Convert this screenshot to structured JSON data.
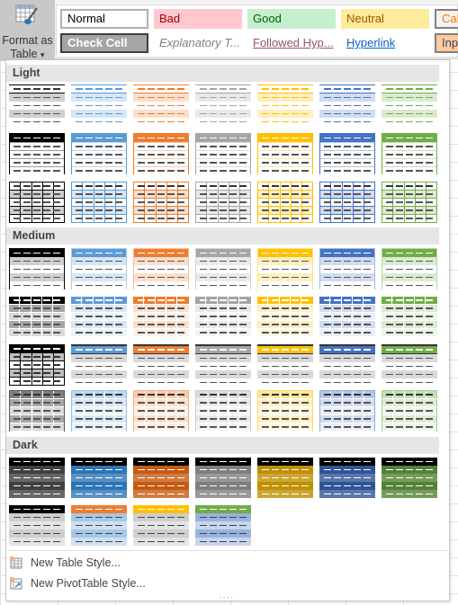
{
  "ribbon": {
    "format_as_table": {
      "line1": "Format as",
      "line2": "Table",
      "icon": "table-format-icon",
      "chevron": "▾"
    },
    "cell_styles": [
      {
        "label": "Normal",
        "bg": "#ffffff",
        "color": "#000000",
        "border": "#b0b0b0"
      },
      {
        "label": "Bad",
        "bg": "#ffc7ce",
        "color": "#9c0006"
      },
      {
        "label": "Good",
        "bg": "#c6efce",
        "color": "#006100"
      },
      {
        "label": "Neutral",
        "bg": "#ffeb9c",
        "color": "#9c5700"
      },
      {
        "label": "Calc",
        "bg": "#f2f2f2",
        "color": "#fa7d00",
        "border": "#7f7f7f"
      },
      {
        "label": "Check Cell",
        "bg": "#a5a5a5",
        "color": "#ffffff",
        "border": "#3f3f3f",
        "bold": true
      },
      {
        "label": "Explanatory T...",
        "bg": "#ffffff",
        "color": "#7f7f7f",
        "italic": true
      },
      {
        "label": "Followed Hyp...",
        "bg": "#ffffff",
        "color": "#954f72",
        "underline": true
      },
      {
        "label": "Hyperlink",
        "bg": "#ffffff",
        "color": "#0563c1",
        "underline": true
      },
      {
        "label": "Inpu",
        "bg": "#ffcc99",
        "color": "#3f3f76",
        "border": "#7f7f7f"
      }
    ]
  },
  "gallery": {
    "sections": [
      {
        "label": "Light",
        "rows": [
          {
            "pattern": "light-banded",
            "colors": [
              "#000000",
              "#5b9bd5",
              "#ed7d31",
              "#a5a5a5",
              "#ffc000",
              "#4472c4",
              "#70ad47"
            ]
          },
          {
            "pattern": "light-header",
            "colors": [
              "#000000",
              "#5b9bd5",
              "#ed7d31",
              "#a5a5a5",
              "#ffc000",
              "#4472c4",
              "#70ad47"
            ]
          },
          {
            "pattern": "light-grid",
            "colors": [
              "#000000",
              "#5b9bd5",
              "#ed7d31",
              "#a5a5a5",
              "#ffc000",
              "#4472c4",
              "#70ad47"
            ]
          }
        ]
      },
      {
        "label": "Medium",
        "rows": [
          {
            "pattern": "medium-banded",
            "colors": [
              "#000000",
              "#5b9bd5",
              "#ed7d31",
              "#a5a5a5",
              "#ffc000",
              "#4472c4",
              "#70ad47"
            ]
          },
          {
            "pattern": "medium-cells",
            "colors": [
              "#000000",
              "#5b9bd5",
              "#ed7d31",
              "#a5a5a5",
              "#ffc000",
              "#4472c4",
              "#70ad47"
            ]
          },
          {
            "pattern": "medium-lines",
            "colors": [
              "#000000",
              "#5b9bd5",
              "#ed7d31",
              "#a5a5a5",
              "#ffc000",
              "#4472c4",
              "#70ad47"
            ]
          },
          {
            "pattern": "medium-tint",
            "colors": [
              "#000000",
              "#5b9bd5",
              "#ed7d31",
              "#a5a5a5",
              "#ffc000",
              "#4472c4",
              "#70ad47"
            ]
          }
        ]
      },
      {
        "label": "Dark",
        "rows": [
          {
            "pattern": "dark-banded",
            "colors": [
              "#404040",
              "#2e75b6",
              "#c55a11",
              "#7f7f7f",
              "#bf9000",
              "#2f5597",
              "#548235"
            ]
          },
          {
            "pattern": "dark-header",
            "colors": [
              "#000000",
              "#ed7d31",
              "#ffc000",
              "#70ad47"
            ],
            "bands": [
              "#a5a5a5",
              "#5b9bd5",
              "#a5a5a5",
              "#4472c4"
            ]
          }
        ]
      }
    ]
  },
  "menu": [
    {
      "label": "New Table Style...",
      "icon": "new-table-style-icon"
    },
    {
      "label": "New PivotTable Style...",
      "icon": "new-pivottable-style-icon"
    }
  ]
}
